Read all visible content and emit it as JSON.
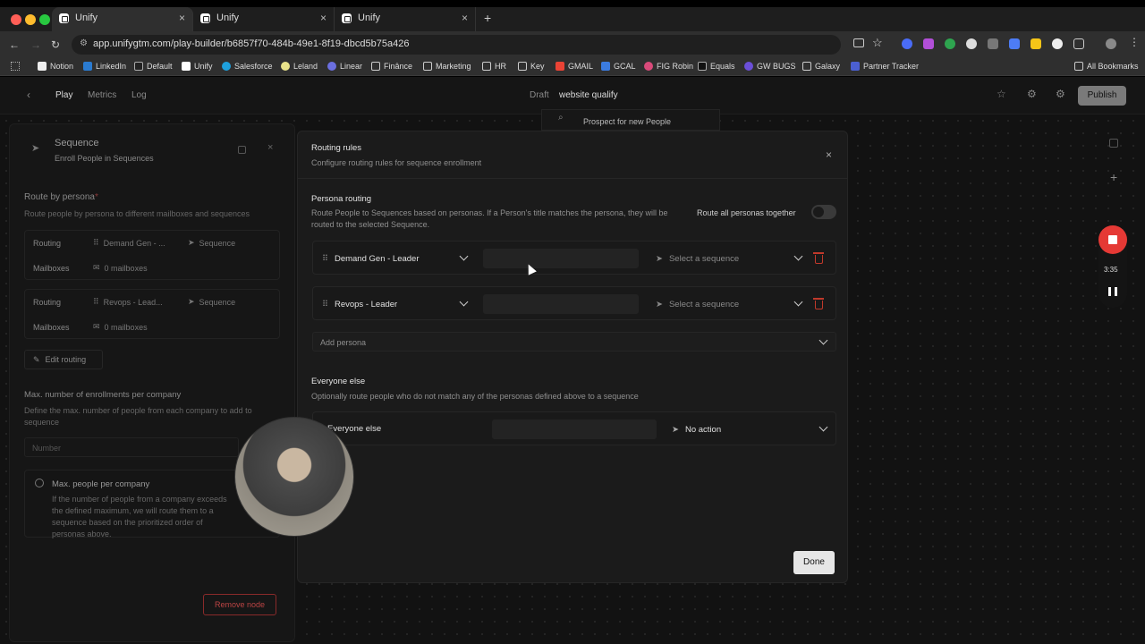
{
  "browser": {
    "tabs": [
      {
        "label": "Unify"
      },
      {
        "label": "Unify"
      },
      {
        "label": "Unify"
      }
    ],
    "url": "app.unifygtm.com/play-builder/b6857f70-484b-49e1-8f19-dbcd5b75a426",
    "bookmarks": [
      "Notion",
      "LinkedIn",
      "Default",
      "Unify",
      "Salesforce",
      "Leland",
      "Linear",
      "Finânce",
      "Marketing",
      "HR",
      "Key",
      "GMAIL",
      "GCAL",
      "FIG Robin",
      "Equals",
      "GW BUGS",
      "Galaxy",
      "Partner Tracker"
    ],
    "all_bookmarks": "All Bookmarks"
  },
  "topbar": {
    "tabs": [
      "Play",
      "Metrics",
      "Log"
    ],
    "status": "Draft",
    "title": "website qualify",
    "publish": "Publish"
  },
  "canvas": {
    "node_label": "Prospect for new People"
  },
  "left_panel": {
    "title": "Sequence",
    "subtitle": "Enroll People in Sequences",
    "route_title": "Route by persona",
    "route_required": "*",
    "route_desc": "Route people by persona to different mailboxes and sequences",
    "routes": [
      {
        "routing_label": "Routing",
        "persona": "Demand Gen - ...",
        "sequence": "Sequence",
        "mailboxes_label": "Mailboxes",
        "mailboxes": "0 mailboxes"
      },
      {
        "routing_label": "Routing",
        "persona": "Revops - Lead...",
        "sequence": "Sequence",
        "mailboxes_label": "Mailboxes",
        "mailboxes": "0 mailboxes"
      }
    ],
    "edit_routing": "Edit routing",
    "max_title": "Max. number of enrollments per company",
    "max_desc": "Define the max. number of people from each company to add to sequence",
    "number_placeholder": "Number",
    "info_title": "Max. people per company",
    "info_desc": "If the number of people from a company exceeds the defined maximum, we will route them to a sequence based on the prioritized order of personas above.",
    "remove_node": "Remove node"
  },
  "modal": {
    "title": "Routing rules",
    "subtitle": "Configure routing rules for sequence enrollment",
    "persona_section": "Persona routing",
    "persona_desc": "Route People to Sequences based on personas. If a Person's title matches the persona, they will be routed to the selected Sequence.",
    "route_all_label": "Route all personas together",
    "personas": [
      {
        "name": "Demand Gen - Leader",
        "sequence_placeholder": "Select a sequence"
      },
      {
        "name": "Revops - Leader",
        "sequence_placeholder": "Select a sequence"
      }
    ],
    "add_persona": "Add persona",
    "everyone_title": "Everyone else",
    "everyone_desc": "Optionally route people who do not match any of the personas defined above to a sequence",
    "everyone_row_label": "Everyone else",
    "everyone_action": "No action",
    "done": "Done"
  },
  "recorder": {
    "time": "3:35"
  },
  "colors": {
    "accent_red": "#e53935",
    "delete_red": "#c0392b",
    "publish_bg": "#7a7a7a"
  }
}
